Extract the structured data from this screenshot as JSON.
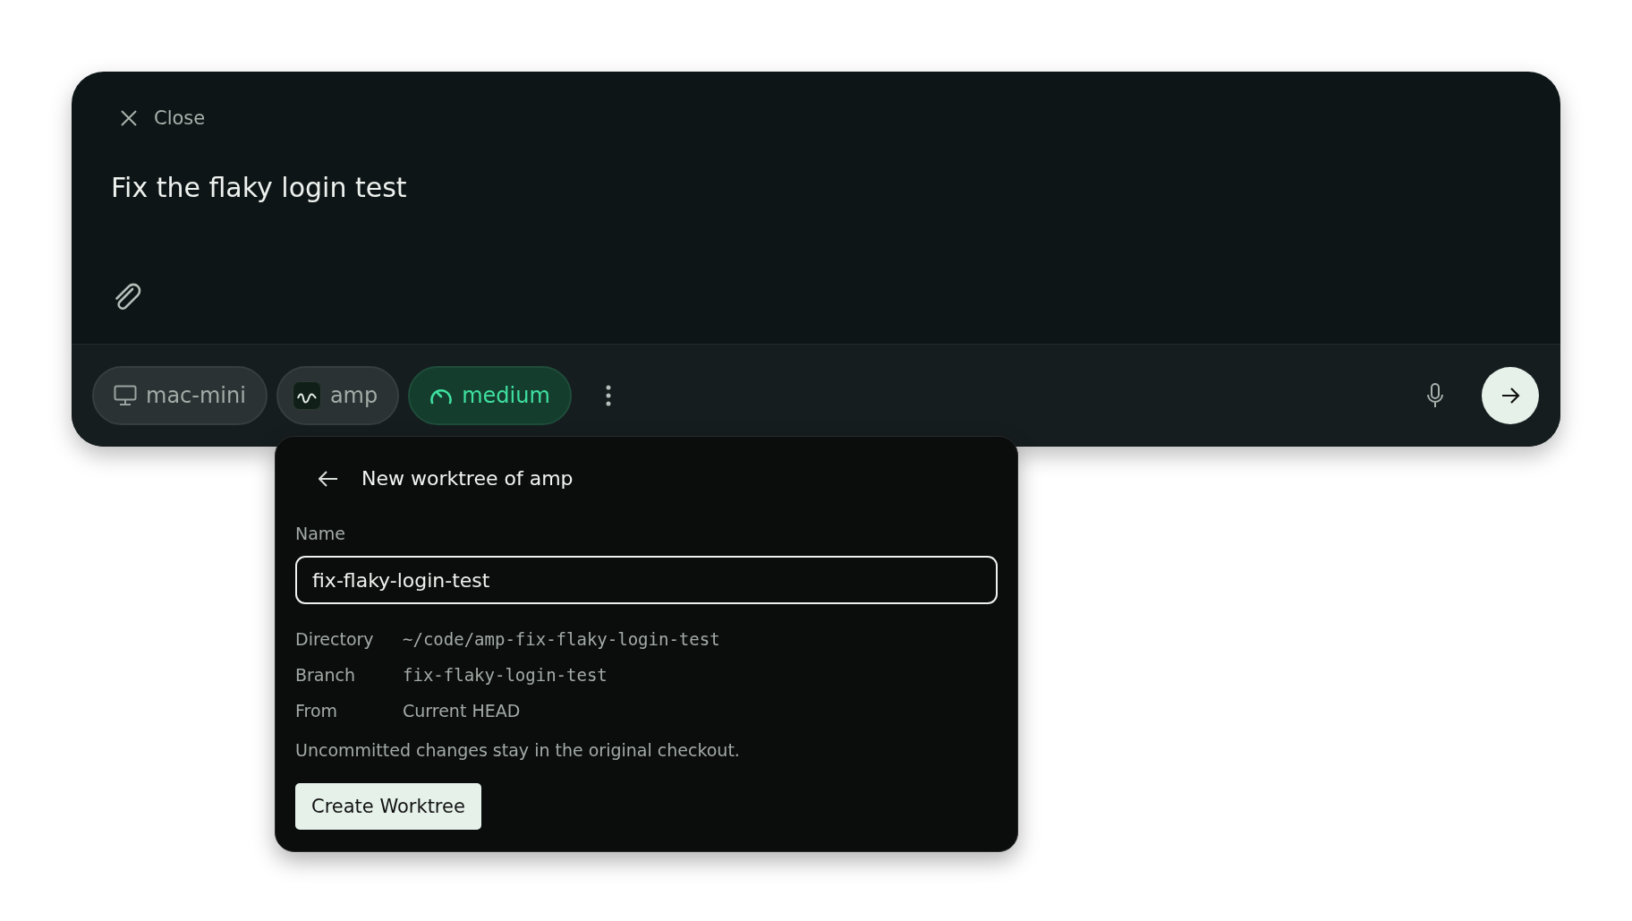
{
  "composer": {
    "close_label": "Close",
    "prompt": "Fix the flaky login test",
    "chips": [
      {
        "kind": "device",
        "label": "mac-mini",
        "selected": false
      },
      {
        "kind": "project",
        "label": "amp",
        "selected": false
      },
      {
        "kind": "effort",
        "label": "medium",
        "selected": true
      }
    ]
  },
  "worktree_popup": {
    "title": "New worktree of amp",
    "name_label": "Name",
    "name_value": "fix-flaky-login-test",
    "details": [
      {
        "label": "Directory",
        "value": "~/code/amp-fix-flaky-login-test",
        "monospace": true
      },
      {
        "label": "Branch",
        "value": "fix-flaky-login-test",
        "monospace": true
      },
      {
        "label": "From",
        "value": "Current HEAD",
        "monospace": false
      }
    ],
    "note": "Uncommitted changes stay in the original checkout.",
    "button": "Create Worktree"
  }
}
